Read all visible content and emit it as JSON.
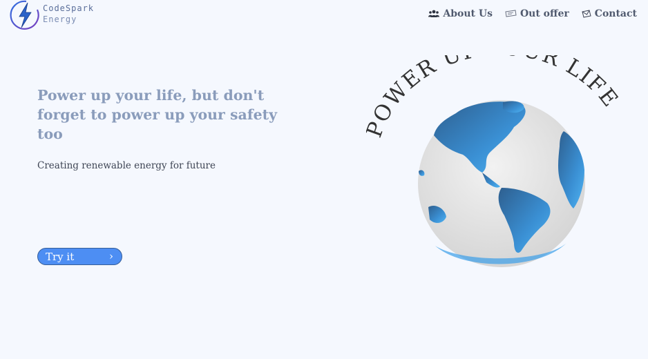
{
  "brand": {
    "line1": "CodeSpark",
    "line2": "Energy",
    "accent_color": "#3c7be0",
    "icon": "lightning-bolt-logo"
  },
  "nav": {
    "items": [
      {
        "label": "About Us",
        "icon": "users-icon"
      },
      {
        "label": "Out offer",
        "icon": "ticket-icon"
      },
      {
        "label": "Contact",
        "icon": "mail-icon"
      }
    ]
  },
  "hero": {
    "title": "Power up your life, but don't forget to power up your safety too",
    "subtitle": "Creating renewable energy for future",
    "cta_label": "Try it",
    "cta_color": "#4d8ef3",
    "title_color": "#8a9cbb"
  },
  "illustration": {
    "arc_text": "POWER UP YOUR LIFE",
    "icon": "earth-globe-image"
  }
}
